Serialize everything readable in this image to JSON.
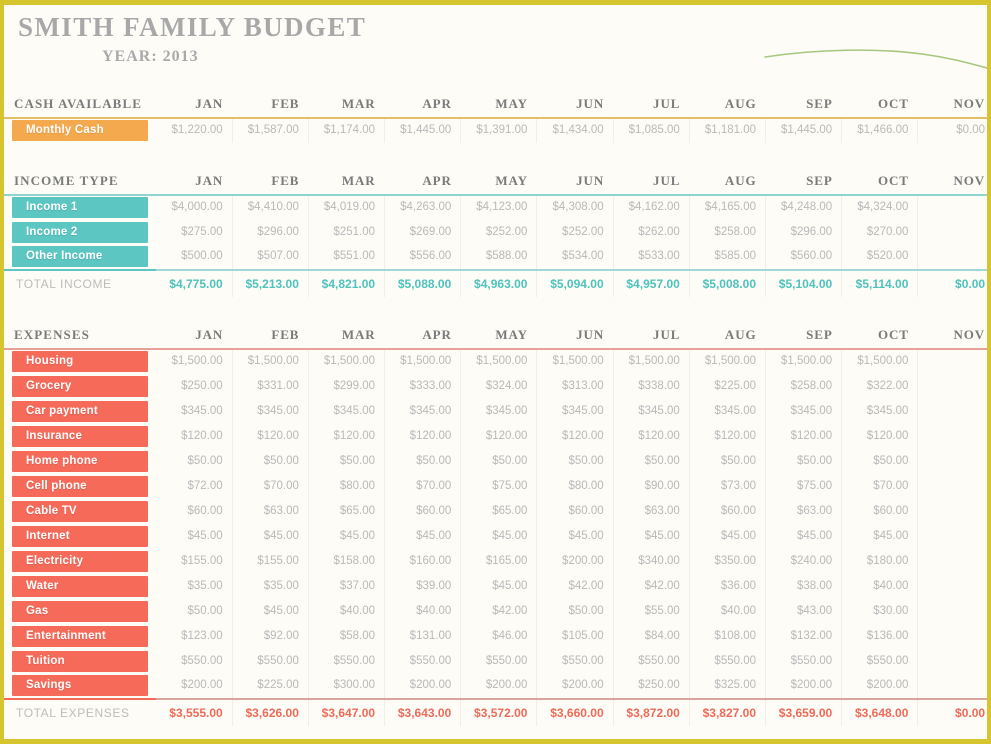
{
  "document": {
    "title": "SMITH FAMILY BUDGET",
    "year_label": "YEAR: 2013"
  },
  "colors": {
    "page_border": "#d6c52e",
    "cash_accent": "#f5a94e",
    "income_accent": "#5cc6c3",
    "expense_accent": "#f66a5a",
    "title_text": "#a8a8a8",
    "value_text": "#b9b9b9",
    "sparkline": "#a7c77f"
  },
  "months": [
    "JAN",
    "FEB",
    "MAR",
    "APR",
    "MAY",
    "JUN",
    "JUL",
    "AUG",
    "SEP",
    "OCT",
    "NOV"
  ],
  "cash": {
    "section_title": "CASH AVAILABLE",
    "row_label": "Monthly Cash",
    "values": [
      "$1,220.00",
      "$1,587.00",
      "$1,174.00",
      "$1,445.00",
      "$1,391.00",
      "$1,434.00",
      "$1,085.00",
      "$1,181.00",
      "$1,445.00",
      "$1,466.00",
      "$0.00"
    ]
  },
  "income": {
    "section_title": "INCOME TYPE",
    "rows": [
      {
        "label": "Income 1",
        "values": [
          "$4,000.00",
          "$4,410.00",
          "$4,019.00",
          "$4,263.00",
          "$4,123.00",
          "$4,308.00",
          "$4,162.00",
          "$4,165.00",
          "$4,248.00",
          "$4,324.00",
          ""
        ]
      },
      {
        "label": "Income 2",
        "values": [
          "$275.00",
          "$296.00",
          "$251.00",
          "$269.00",
          "$252.00",
          "$252.00",
          "$262.00",
          "$258.00",
          "$296.00",
          "$270.00",
          ""
        ]
      },
      {
        "label": "Other Income",
        "values": [
          "$500.00",
          "$507.00",
          "$551.00",
          "$556.00",
          "$588.00",
          "$534.00",
          "$533.00",
          "$585.00",
          "$560.00",
          "$520.00",
          ""
        ]
      }
    ],
    "total_label": "TOTAL INCOME",
    "total_values": [
      "$4,775.00",
      "$5,213.00",
      "$4,821.00",
      "$5,088.00",
      "$4,963.00",
      "$5,094.00",
      "$4,957.00",
      "$5,008.00",
      "$5,104.00",
      "$5,114.00",
      "$0.00"
    ]
  },
  "expenses": {
    "section_title": "EXPENSES",
    "rows": [
      {
        "label": "Housing",
        "values": [
          "$1,500.00",
          "$1,500.00",
          "$1,500.00",
          "$1,500.00",
          "$1,500.00",
          "$1,500.00",
          "$1,500.00",
          "$1,500.00",
          "$1,500.00",
          "$1,500.00",
          ""
        ]
      },
      {
        "label": "Grocery",
        "values": [
          "$250.00",
          "$331.00",
          "$299.00",
          "$333.00",
          "$324.00",
          "$313.00",
          "$338.00",
          "$225.00",
          "$258.00",
          "$322.00",
          ""
        ]
      },
      {
        "label": "Car payment",
        "values": [
          "$345.00",
          "$345.00",
          "$345.00",
          "$345.00",
          "$345.00",
          "$345.00",
          "$345.00",
          "$345.00",
          "$345.00",
          "$345.00",
          ""
        ]
      },
      {
        "label": "Insurance",
        "values": [
          "$120.00",
          "$120.00",
          "$120.00",
          "$120.00",
          "$120.00",
          "$120.00",
          "$120.00",
          "$120.00",
          "$120.00",
          "$120.00",
          ""
        ]
      },
      {
        "label": "Home phone",
        "values": [
          "$50.00",
          "$50.00",
          "$50.00",
          "$50.00",
          "$50.00",
          "$50.00",
          "$50.00",
          "$50.00",
          "$50.00",
          "$50.00",
          ""
        ]
      },
      {
        "label": "Cell phone",
        "values": [
          "$72.00",
          "$70.00",
          "$80.00",
          "$70.00",
          "$75.00",
          "$80.00",
          "$90.00",
          "$73.00",
          "$75.00",
          "$70.00",
          ""
        ]
      },
      {
        "label": "Cable TV",
        "values": [
          "$60.00",
          "$63.00",
          "$65.00",
          "$60.00",
          "$65.00",
          "$60.00",
          "$63.00",
          "$60.00",
          "$63.00",
          "$60.00",
          ""
        ]
      },
      {
        "label": "Internet",
        "values": [
          "$45.00",
          "$45.00",
          "$45.00",
          "$45.00",
          "$45.00",
          "$45.00",
          "$45.00",
          "$45.00",
          "$45.00",
          "$45.00",
          ""
        ]
      },
      {
        "label": "Electricity",
        "values": [
          "$155.00",
          "$155.00",
          "$158.00",
          "$160.00",
          "$165.00",
          "$200.00",
          "$340.00",
          "$350.00",
          "$240.00",
          "$180.00",
          ""
        ]
      },
      {
        "label": "Water",
        "values": [
          "$35.00",
          "$35.00",
          "$37.00",
          "$39.00",
          "$45.00",
          "$42.00",
          "$42.00",
          "$36.00",
          "$38.00",
          "$40.00",
          ""
        ]
      },
      {
        "label": "Gas",
        "values": [
          "$50.00",
          "$45.00",
          "$40.00",
          "$40.00",
          "$42.00",
          "$50.00",
          "$55.00",
          "$40.00",
          "$43.00",
          "$30.00",
          ""
        ]
      },
      {
        "label": "Entertainment",
        "values": [
          "$123.00",
          "$92.00",
          "$58.00",
          "$131.00",
          "$46.00",
          "$105.00",
          "$84.00",
          "$108.00",
          "$132.00",
          "$136.00",
          ""
        ]
      },
      {
        "label": "Tuition",
        "values": [
          "$550.00",
          "$550.00",
          "$550.00",
          "$550.00",
          "$550.00",
          "$550.00",
          "$550.00",
          "$550.00",
          "$550.00",
          "$550.00",
          ""
        ]
      },
      {
        "label": "Savings",
        "values": [
          "$200.00",
          "$225.00",
          "$300.00",
          "$200.00",
          "$200.00",
          "$200.00",
          "$250.00",
          "$325.00",
          "$200.00",
          "$200.00",
          ""
        ]
      }
    ],
    "total_label": "TOTAL EXPENSES",
    "total_values": [
      "$3,555.00",
      "$3,626.00",
      "$3,647.00",
      "$3,643.00",
      "$3,572.00",
      "$3,660.00",
      "$3,872.00",
      "$3,827.00",
      "$3,659.00",
      "$3,648.00",
      "$0.00"
    ]
  }
}
